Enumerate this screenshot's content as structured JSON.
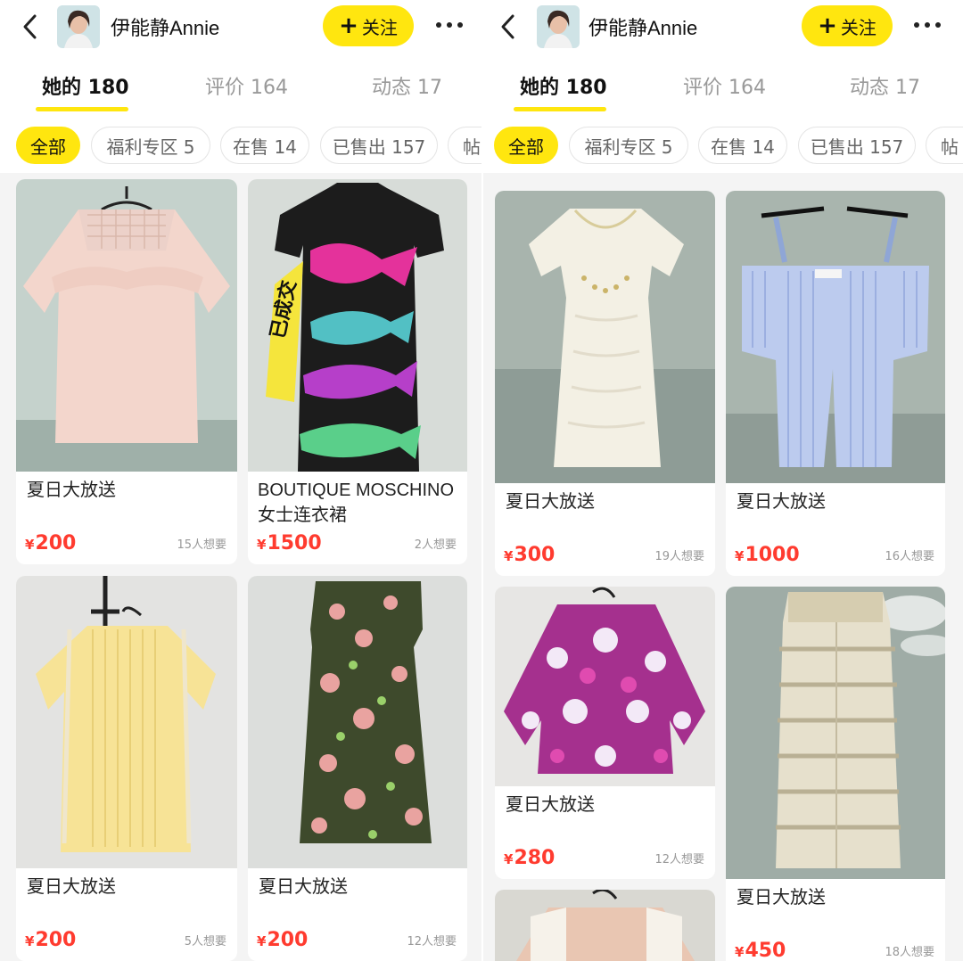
{
  "panels": [
    {
      "header": {
        "name": "伊能静Annie",
        "follow_label": "关注"
      },
      "tabs": [
        {
          "label": "她的 180"
        },
        {
          "label": "评价 164"
        },
        {
          "label": "动态 17"
        }
      ],
      "chips": [
        {
          "label": "全部"
        },
        {
          "label": "福利专区 5"
        },
        {
          "label": "在售 14"
        },
        {
          "label": "已售出 157"
        },
        {
          "label": "帖"
        }
      ],
      "items": [
        {
          "title": "夏日大放送",
          "title2": "",
          "price": "200",
          "wants": "15人想要"
        },
        {
          "title": "BOUTIQUE MOSCHINO",
          "title2": "女士连衣裙",
          "price": "1500",
          "wants": "2人想要",
          "tag": "已成交"
        },
        {
          "title": "夏日大放送",
          "title2": "",
          "price": "200",
          "wants": "5人想要"
        },
        {
          "title": "夏日大放送",
          "title2": "",
          "price": "200",
          "wants": "12人想要"
        }
      ]
    },
    {
      "header": {
        "name": "伊能静Annie",
        "follow_label": "关注"
      },
      "tabs": [
        {
          "label": "她的 180"
        },
        {
          "label": "评价 164"
        },
        {
          "label": "动态 17"
        }
      ],
      "chips": [
        {
          "label": "全部"
        },
        {
          "label": "福利专区 5"
        },
        {
          "label": "在售 14"
        },
        {
          "label": "已售出 157"
        },
        {
          "label": "帖"
        }
      ],
      "items": [
        {
          "title": "夏日大放送",
          "title2": "",
          "price": "300",
          "wants": "19人想要"
        },
        {
          "title": "夏日大放送",
          "title2": "",
          "price": "1000",
          "wants": "16人想要"
        },
        {
          "title": "夏日大放送",
          "title2": "",
          "price": "280",
          "wants": "12人想要"
        },
        {
          "title": "夏日大放送",
          "title2": "",
          "price": "450",
          "wants": "18人想要"
        }
      ]
    }
  ],
  "currency_symbol": "¥",
  "colors": {
    "accent": "#ffe60f",
    "price": "#ff3b2f",
    "muted": "#999999"
  }
}
